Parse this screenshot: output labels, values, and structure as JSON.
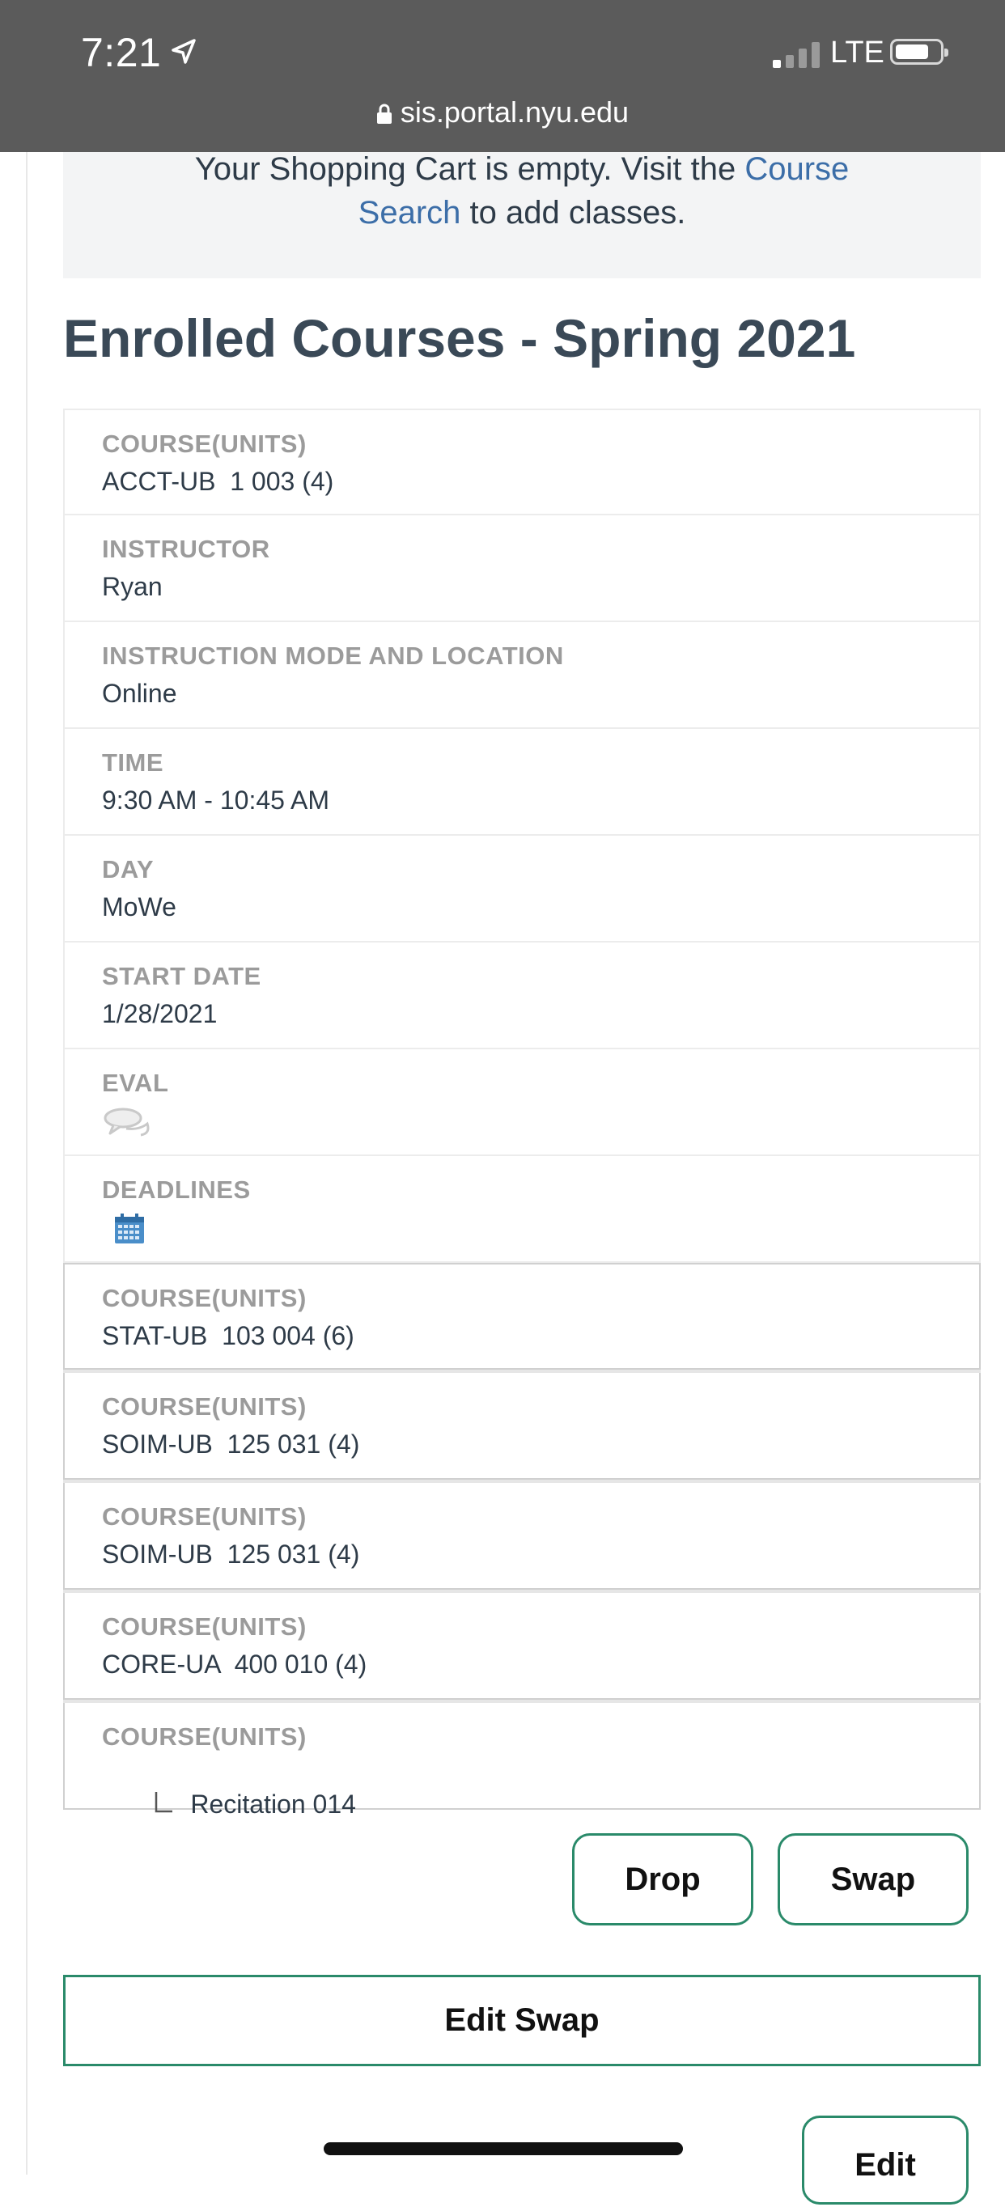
{
  "status_bar": {
    "time": "7:21",
    "network": "LTE",
    "url": "sis.portal.nyu.edu"
  },
  "cart": {
    "text_before": "Your Shopping Cart is empty. Visit the ",
    "link": "Course Search",
    "text_after": " to add classes."
  },
  "heading": "Enrolled Courses - Spring 2021",
  "details": [
    {
      "label": "COURSE(UNITS)",
      "value": "ACCT-UB  1 003 (4)"
    },
    {
      "label": "INSTRUCTOR",
      "value": "Ryan"
    },
    {
      "label": "INSTRUCTION MODE AND LOCATION",
      "value": "Online"
    },
    {
      "label": "TIME",
      "value": "9:30 AM - 10:45 AM"
    },
    {
      "label": "DAY",
      "value": "MoWe"
    },
    {
      "label": "START DATE",
      "value": "1/28/2021"
    },
    {
      "label": "EVAL",
      "icon": "speech-bubbles-icon"
    },
    {
      "label": "DEADLINES",
      "icon": "calendar-icon"
    }
  ],
  "other_courses": [
    {
      "label": "COURSE(UNITS)",
      "value": "STAT-UB  103 004 (6)"
    },
    {
      "label": "COURSE(UNITS)",
      "value": "SOIM-UB  125 031 (4)"
    },
    {
      "label": "COURSE(UNITS)",
      "value": "SOIM-UB  125 031 (4)"
    },
    {
      "label": "COURSE(UNITS)",
      "value": "CORE-UA  400 010 (4)"
    },
    {
      "label": "COURSE(UNITS)",
      "value": "Recitation 014"
    }
  ],
  "buttons": {
    "drop": "Drop",
    "swap": "Swap",
    "edit_swap": "Edit Swap",
    "edit": "Edit"
  },
  "colors": {
    "accent_green": "#2a8a6a",
    "link_blue": "#3c6ea8",
    "heading": "#3a4957"
  }
}
